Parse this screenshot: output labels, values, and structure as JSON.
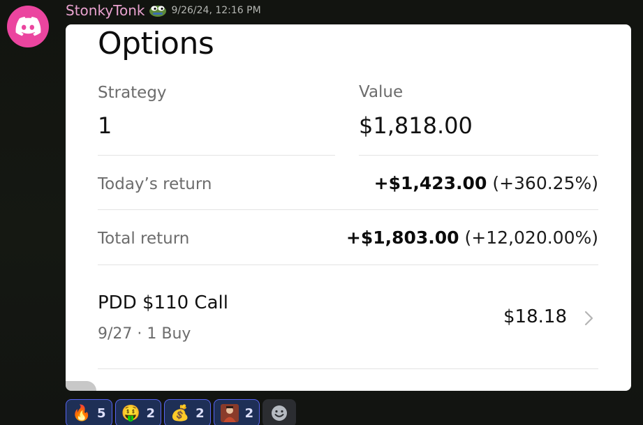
{
  "message": {
    "username": "StonkyTonk",
    "timestamp": "9/26/24, 12:16 PM",
    "avatar_icon": "discord-logo-icon",
    "username_color": "#e9a2cf",
    "avatar_color": "#eb459f"
  },
  "card": {
    "title": "Options",
    "strategy_label": "Strategy",
    "strategy_value": "1",
    "value_label": "Value",
    "value_value": "$1,818.00",
    "todays_return_label": "Today’s return",
    "todays_return_amount": "+$1,423.00",
    "todays_return_pct": "(+360.25%)",
    "total_return_label": "Total return",
    "total_return_amount": "+$1,803.00",
    "total_return_pct": "(+12,020.00%)",
    "position": {
      "name": "PDD $110 Call",
      "subtitle": "9/27 · 1 Buy",
      "price": "$18.18"
    }
  },
  "reactions": [
    {
      "emoji": "🔥",
      "icon": "fire-emoji",
      "count": "5"
    },
    {
      "emoji": "🤑",
      "icon": "money-mouth-emoji",
      "count": "2"
    },
    {
      "emoji": "💰",
      "icon": "money-bag-emoji",
      "count": "2"
    },
    {
      "emoji": "",
      "icon": "custom-character-emoji",
      "count": "2"
    }
  ]
}
